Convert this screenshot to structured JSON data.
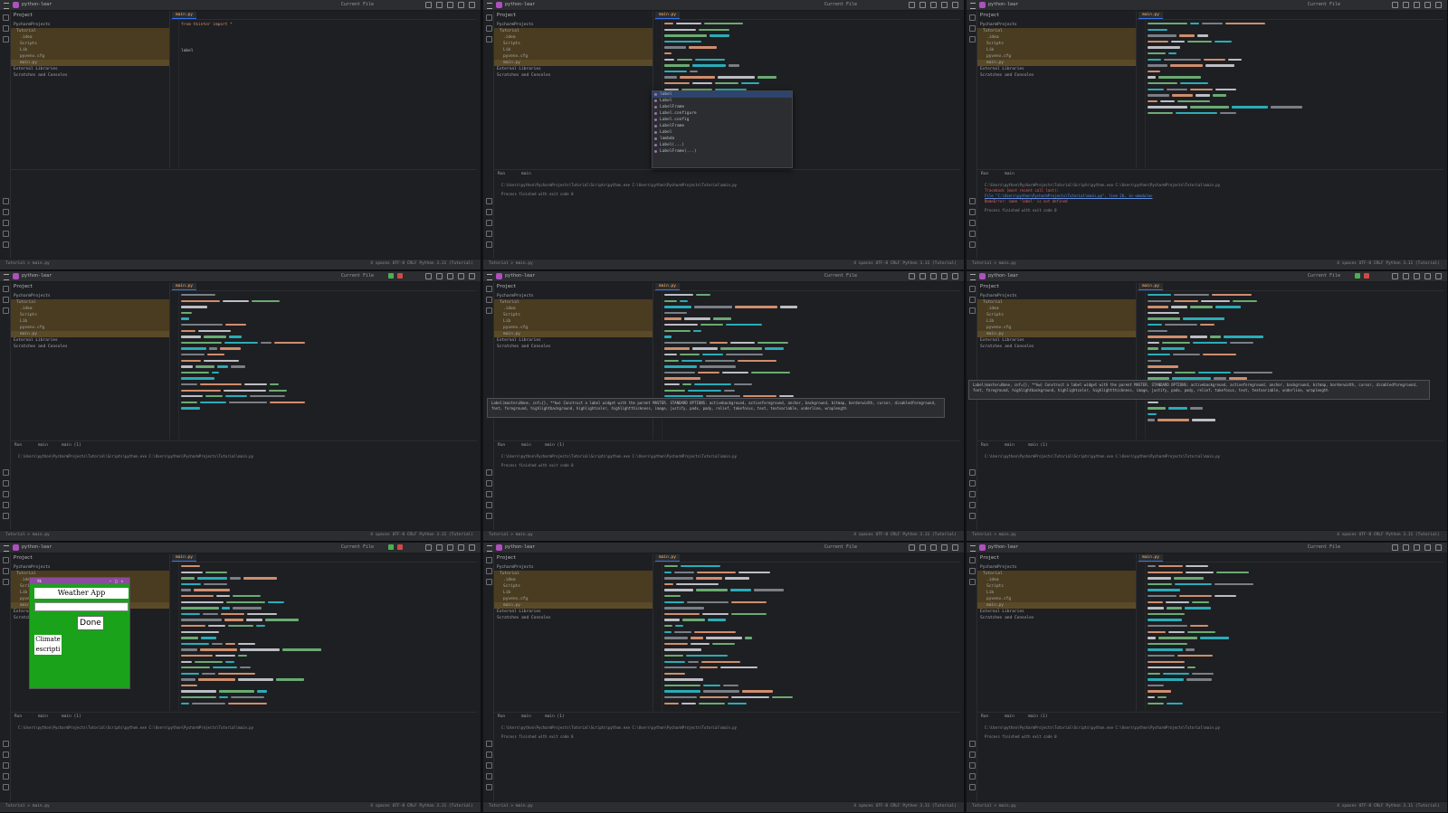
{
  "ide": {
    "project_name": "python-lear",
    "branch": "main",
    "project_header": "Project",
    "run_config": "Current File",
    "file_tab": "main.py",
    "editor_label": "Reader Mode",
    "tree": [
      "PycharmProjects",
      "Tutorial",
      ".idea",
      "Scripts",
      "Lib",
      "pyvenv.cfg",
      "main.py",
      "External Libraries",
      "Scratches and Consoles"
    ],
    "bottom_tabs": [
      "Run",
      "main",
      "main (1)"
    ],
    "run_command": "C:\\Users\\python\\PycharmProjects\\Tutorial\\Scripts\\python.exe C:\\Users\\python\\PycharmProjects\\Tutorial\\main.py",
    "process_exit": "Process finished with exit code 0",
    "error_traceback": "Traceback (most recent call last):",
    "error_file": "File \"C:\\Users\\python\\PycharmProjects\\Tutorial\\main.py\", line 26, in <module>",
    "error_message": "NameError: name 'label' is not defined",
    "status_left": "Tutorial > main.py",
    "status_right": "4 spaces  UTF-8  CRLF  Python 3.11 (Tutorial)",
    "first_code_line": "from tkinter import *",
    "typed_text": "label"
  },
  "completion": {
    "items": [
      "label",
      "Label",
      "LabelFrame",
      "Label.configure",
      "Label.config",
      "LabelFrame",
      "Label",
      "lambda",
      "Label(...)",
      "LabelFrame(...)"
    ]
  },
  "tooltip": {
    "text": "Label(master=None, cnf={}, **kw)  Construct a label widget with the parent MASTER. STANDARD OPTIONS: activebackground, activeforeground, anchor, background, bitmap, borderwidth, cursor, disabledforeground, font, foreground, highlightbackground, highlightcolor, highlightthickness, image, justify, padx, pady, relief, takefocus, text, textvariable, underline, wraplength"
  },
  "tk_app": {
    "window_title": "tk",
    "title_label": "Weather App",
    "button_label": "Done",
    "climate_label": "Climate escripti"
  },
  "colors": {
    "app_green": "#1aa21a",
    "ide_background": "#1e1f22",
    "highlight_folder": "#4a3c20"
  }
}
